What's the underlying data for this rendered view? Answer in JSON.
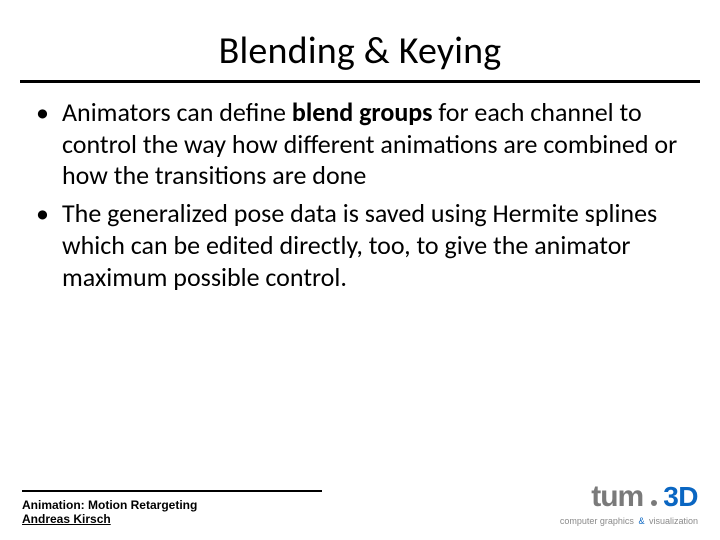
{
  "title": "Blending & Keying",
  "bullets": [
    {
      "pre": "Animators can define ",
      "bold": "blend groups",
      "post": " for each channel to control the way how different animations are combined or how the transitions are done"
    },
    {
      "pre": "The generalized pose data is saved using Hermite splines which can be edited directly, too, to give the animator maximum possible control.",
      "bold": "",
      "post": ""
    }
  ],
  "footer": {
    "line1": "Animation: Motion Retargeting",
    "line2": "Andreas Kirsch"
  },
  "logo": {
    "tum": "tum",
    "threeD": "3D",
    "tagline_left": "computer graphics",
    "tagline_amp": "&",
    "tagline_right": "visualization"
  }
}
